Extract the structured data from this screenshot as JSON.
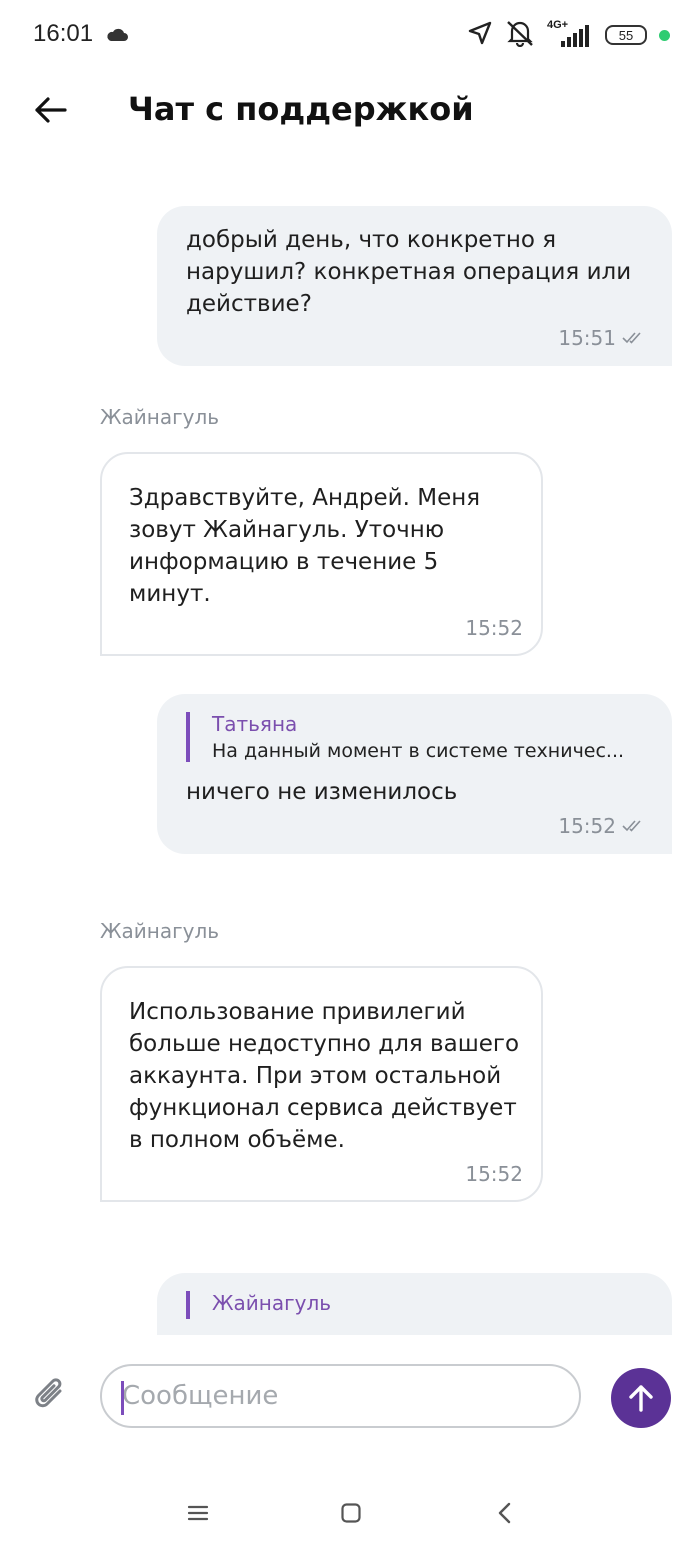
{
  "status_bar": {
    "time": "16:01",
    "battery": "55",
    "network": "4G+",
    "icons": [
      "cloud-icon",
      "location-arrow-icon",
      "bell-off-icon",
      "signal-icon",
      "battery-icon"
    ],
    "dot_color": "#2ecc71"
  },
  "header": {
    "title": "Чат с поддержкой"
  },
  "messages": [
    {
      "direction": "out",
      "text": "добрый день, что конкретно я нарушил? конкретная операция или действие?",
      "time": "15:51",
      "read": true
    },
    {
      "direction": "in",
      "sender": "Жайнагуль",
      "text": "Здравствуйте, Андрей. Меня зовут Жайнагуль. Уточню информацию в течение 5 минут.",
      "time": "15:52"
    },
    {
      "direction": "out",
      "quote": {
        "name": "Татьяна",
        "text": "На данный момент в системе техничес..."
      },
      "text": "ничего не изменилось",
      "time": "15:52",
      "read": true
    },
    {
      "direction": "in",
      "sender": "Жайнагуль",
      "text": "Использование привилегий больше недоступно для вашего аккаунта. При этом остальной функционал сервиса действует в полном объёме.",
      "time": "15:52"
    },
    {
      "direction": "out",
      "quote": {
        "name": "Жайнагуль",
        "text": ""
      },
      "text": "",
      "time": "",
      "read": false
    }
  ],
  "composer": {
    "placeholder": "Сообщение"
  },
  "colors": {
    "accent": "#5b3296",
    "quote_bar": "#7c4dbb",
    "outgoing_bubble": "#eff2f5",
    "meta_text": "#8a9098"
  }
}
